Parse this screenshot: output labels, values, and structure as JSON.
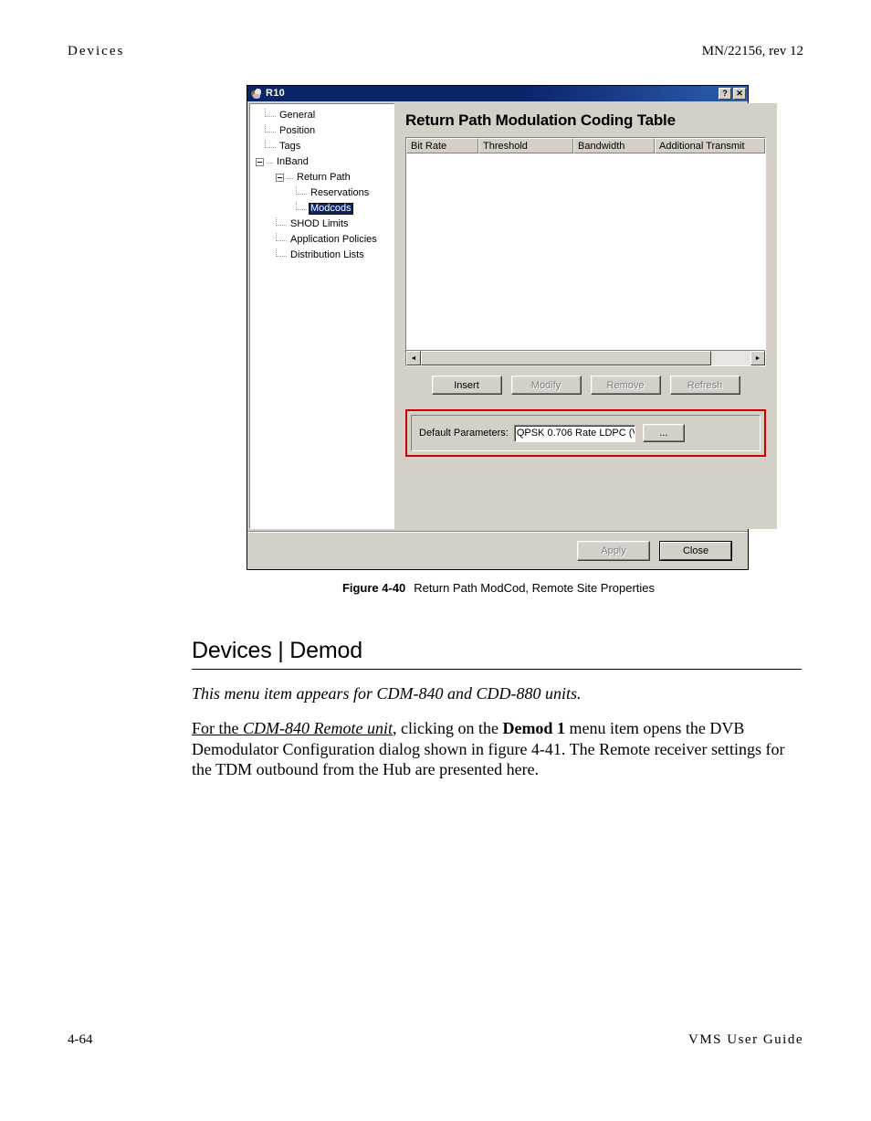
{
  "page": {
    "header_left": "Devices",
    "header_right": "MN/22156, rev 12",
    "footer_left": "4-64",
    "footer_right": "VMS User Guide"
  },
  "figure": {
    "caption_number": "Figure 4-40",
    "caption_text": "Return Path ModCod, Remote Site Properties"
  },
  "dialog": {
    "title": "R10",
    "help_button": "?",
    "close_button": "✕",
    "panel_title": "Return Path Modulation Coding Table",
    "tree": {
      "items": [
        {
          "label": "General",
          "level": 1,
          "expander": "none",
          "selected": false
        },
        {
          "label": "Position",
          "level": 1,
          "expander": "none",
          "selected": false
        },
        {
          "label": "Tags",
          "level": 1,
          "expander": "none",
          "selected": false
        },
        {
          "label": "InBand",
          "level": 0,
          "expander": "minus",
          "selected": false
        },
        {
          "label": "Return Path",
          "level": 1,
          "expander": "minus",
          "selected": false
        },
        {
          "label": "Reservations",
          "level": 3,
          "expander": "none",
          "selected": false
        },
        {
          "label": "Modcods",
          "level": 3,
          "expander": "none",
          "selected": true
        },
        {
          "label": "SHOD Limits",
          "level": 1,
          "expander": "none",
          "selected": false
        },
        {
          "label": "Application Policies",
          "level": 1,
          "expander": "none",
          "selected": false
        },
        {
          "label": "Distribution Lists",
          "level": 1,
          "expander": "none",
          "selected": false
        }
      ]
    },
    "table": {
      "columns": [
        "Bit Rate",
        "Threshold",
        "Bandwidth",
        "Additional Transmit"
      ],
      "rows": []
    },
    "scrollbar": {
      "left_arrow": "◄",
      "right_arrow": "►"
    },
    "list_buttons": [
      {
        "label": "Insert",
        "enabled": true
      },
      {
        "label": "Modify",
        "enabled": false
      },
      {
        "label": "Remove",
        "enabled": false
      },
      {
        "label": "Refresh",
        "enabled": false
      }
    ],
    "default_parameters": {
      "label": "Default Parameters:",
      "value": "QPSK 0.706 Rate  LDPC (V",
      "browse_label": "...",
      "highlight_color": "#cc0000"
    },
    "footer_buttons": {
      "apply": "Apply",
      "close": "Close"
    }
  },
  "content": {
    "heading": "Devices | Demod",
    "intro": "This menu item appears for CDM-840 and CDD-880 units.",
    "paragraph": {
      "seg_for_the": "For the ",
      "seg_unit": "CDM-840 Remote unit",
      "seg_mid": ", clicking on the ",
      "seg_demod": "Demod 1",
      "seg_rest": " menu item opens the DVB Demodulator Configuration dialog shown in figure 4-41. The Remote receiver settings for the TDM outbound from the Hub are presented here."
    }
  }
}
